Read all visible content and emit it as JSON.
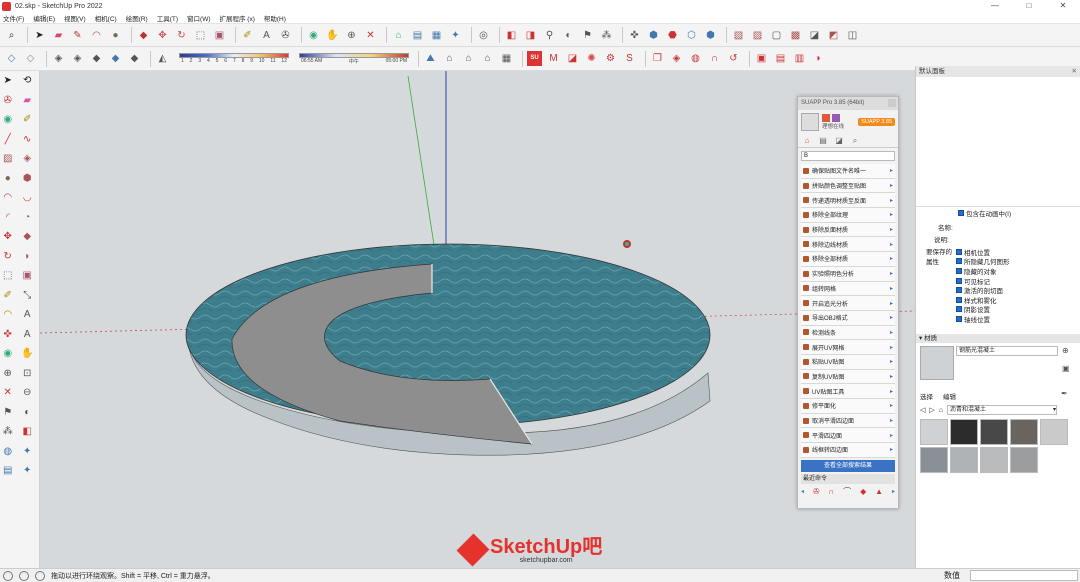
{
  "window": {
    "title": "02.skp - SketchUp Pro 2022",
    "controls": [
      "—",
      "□",
      "✕"
    ]
  },
  "menu": [
    "文件(F)",
    "编辑(E)",
    "视图(V)",
    "相机(C)",
    "绘图(R)",
    "工具(T)",
    "窗口(W)",
    "扩展程序 (x)",
    "帮助(H)"
  ],
  "shadow_bar": {
    "months": [
      "1",
      "2",
      "3",
      "4",
      "5",
      "6",
      "7",
      "8",
      "9",
      "10",
      "11",
      "12"
    ],
    "time_start": "06:55 AM",
    "time_mid": "中午",
    "time_end": "05:00 PM"
  },
  "suapp": {
    "title": "SUAPP Pro 3.85 (64bit)",
    "brand": "SUAPP",
    "badge": "SUAPP 3.85",
    "user_status": "理想在线",
    "search_value": "B",
    "items": [
      "确保贴图文件名唯一",
      "拼贴颜色调整至贴图",
      "传递透明材质至反面",
      "移除全部纹理",
      "移除反面材质",
      "移除边线材质",
      "移除全部材质",
      "实验照明色分析",
      "组转网格",
      "开启追光分析",
      "导出OBJ格式",
      "检测线条",
      "展开UV网格",
      "粘贴UV贴图",
      "复制UV贴图",
      "UV贴图工具",
      "修平面化",
      "取消平滑四边面",
      "平滑四边面",
      "线框转四边面"
    ],
    "footer_button": "查看全部搜索结果",
    "recent_label": "最近命令"
  },
  "default_panel": {
    "title": "默认面板",
    "animation_checkbox": "包含在动画中(I)",
    "name_label": "名称:",
    "desc_label": "说明:",
    "saved_props_label": "要保存的属性",
    "properties": [
      "相机位置",
      "所隐藏几何图形",
      "隐藏的对象",
      "可见标记",
      "激活的剖切面",
      "样式和雾化",
      "阴影设置",
      "轴线位置"
    ]
  },
  "materials": {
    "section_title": "材质",
    "current_material": "钢筋光混凝土",
    "tabs": [
      "选择",
      "编辑"
    ],
    "library": "沥青和混凝土",
    "swatch_colors": [
      "#cfd2d4",
      "#2c2c2c",
      "#4a4846",
      "#6a6460",
      "#c9cacb",
      "#8a9196",
      "#aeb2b4",
      "#b9bbbc",
      "#9a9ea1"
    ]
  },
  "status": {
    "message": "拖动以进行环绕观察。Shift = 平移, Ctrl = 重力悬浮。",
    "measurements_label": "数值"
  },
  "watermark": {
    "logo": "SketchUp吧",
    "url": "sketchupbar.com"
  },
  "colors": {
    "accent": "#1f6fd1",
    "water": "#3d7d8c",
    "concrete": "#8e8e8e",
    "brand_red": "#e5322d"
  }
}
